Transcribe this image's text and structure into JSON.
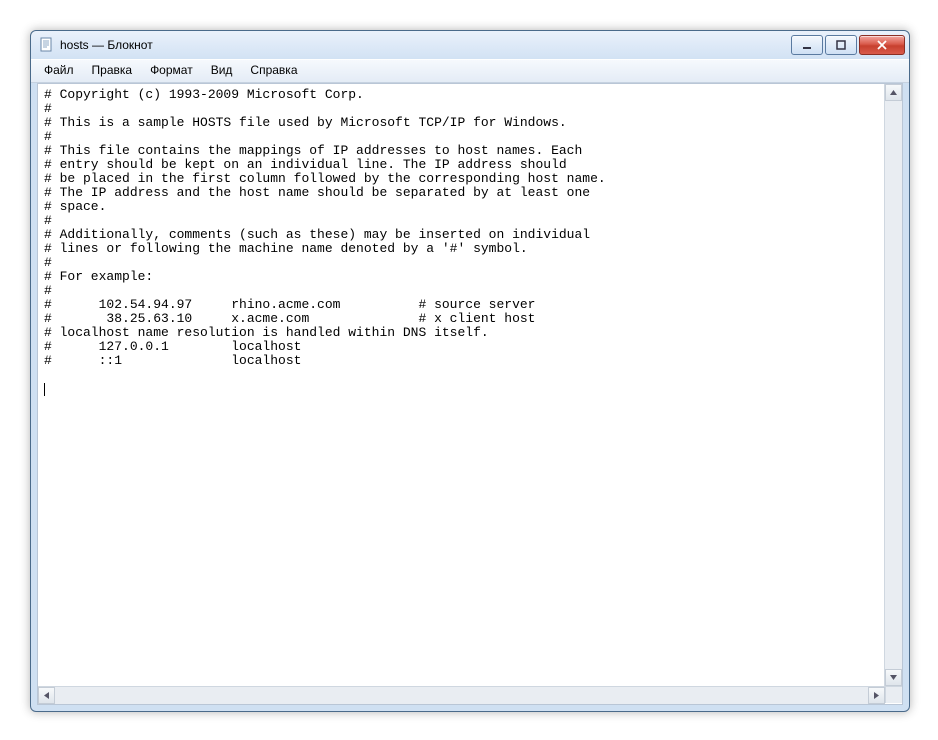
{
  "window": {
    "title": "hosts — Блокнот"
  },
  "menu": {
    "file": "Файл",
    "edit": "Правка",
    "format": "Формат",
    "view": "Вид",
    "help": "Справка"
  },
  "editor": {
    "content": "# Copyright (c) 1993-2009 Microsoft Corp.\n#\n# This is a sample HOSTS file used by Microsoft TCP/IP for Windows.\n#\n# This file contains the mappings of IP addresses to host names. Each\n# entry should be kept on an individual line. The IP address should\n# be placed in the first column followed by the corresponding host name.\n# The IP address and the host name should be separated by at least one\n# space.\n#\n# Additionally, comments (such as these) may be inserted on individual\n# lines or following the machine name denoted by a '#' symbol.\n#\n# For example:\n#\n#      102.54.94.97     rhino.acme.com          # source server\n#       38.25.63.10     x.acme.com              # x client host\n# localhost name resolution is handled within DNS itself.\n#      127.0.0.1        localhost\n#      ::1              localhost\n"
  }
}
